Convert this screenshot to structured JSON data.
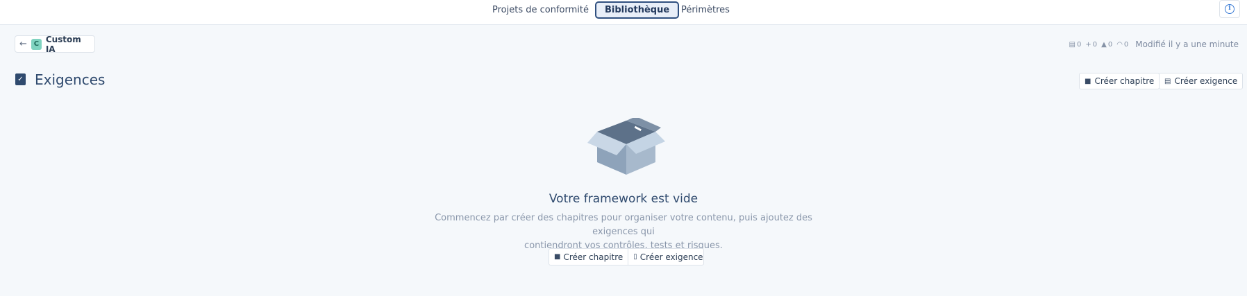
{
  "nav": {
    "tabs": [
      {
        "label": "Projets de conformité",
        "active": false
      },
      {
        "label": "Bibliothèque",
        "active": true
      },
      {
        "label": "Périmètres",
        "active": false
      }
    ],
    "info_icon": "info-icon"
  },
  "library": {
    "avatar_letter": "C",
    "name": "Custom IA",
    "avatar_color": "#7fd3c0"
  },
  "stats": {
    "requirements": "0",
    "controls": "0",
    "risks": "0",
    "tests": "0",
    "modified": "Modifié il y a une minute"
  },
  "section": {
    "title": "Exigences",
    "create_chapter": "Créer chapitre",
    "create_requirement": "Créer exigence"
  },
  "empty_state": {
    "title": "Votre framework est vide",
    "description_line1": "Commencez par créer des chapitres pour organiser votre contenu, puis ajoutez des exigences qui",
    "description_line2": "contiendront vos contrôles, tests et risques.",
    "create_chapter": "Créer chapitre",
    "create_requirement": "Créer exigence"
  },
  "colors": {
    "accent": "#2f4f7f",
    "background": "#f5f8fb",
    "info": "#3a7bd5"
  }
}
